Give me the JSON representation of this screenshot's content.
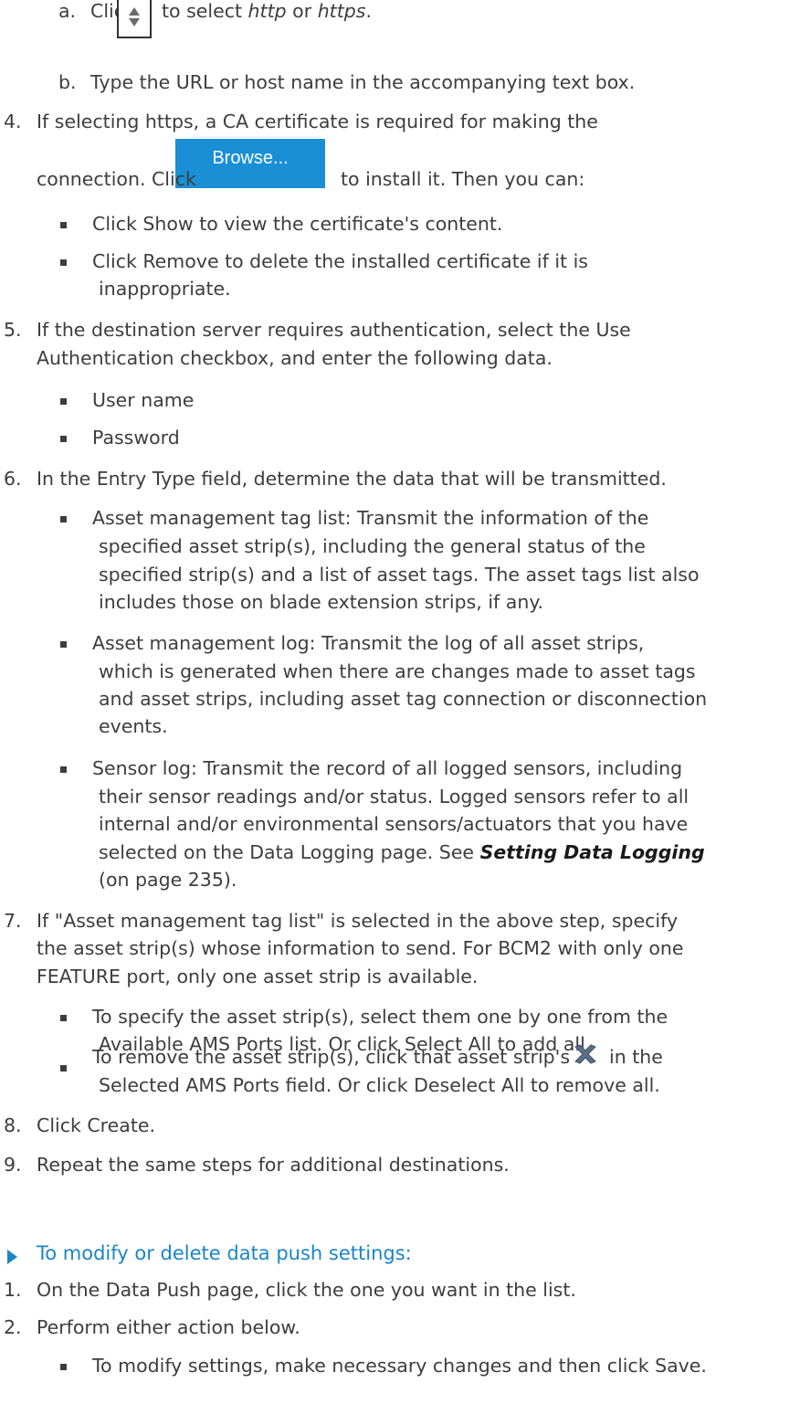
{
  "step3": {
    "a_num": "a.",
    "a_click": "Click",
    "a_to_select": "to select",
    "a_http": "http",
    "a_or": "or",
    "a_https": "https",
    "a_end": ".",
    "b_num": "b.",
    "b_text": "Type the URL or host name in the accompanying text box."
  },
  "step4": {
    "num": "4.",
    "line1": "If selecting https, a CA certificate is required for making the",
    "line2_pre": "connection. Click",
    "line2_post": "to install it. Then you can:",
    "browse_label": "Browse...",
    "bullets": [
      {
        "lines": [
          "Click Show to view the certificate's content."
        ]
      },
      {
        "lines": [
          "Click Remove to delete the installed certificate if it is",
          "inappropriate."
        ]
      }
    ]
  },
  "step5": {
    "num": "5.",
    "lines": [
      "If the destination server requires authentication, select the Use",
      "Authentication checkbox, and enter the following data."
    ],
    "bullets": [
      "User name",
      "Password"
    ]
  },
  "step6": {
    "num": "6.",
    "line": "In the Entry Type field, determine the data that will be transmitted.",
    "bullet1": [
      "Asset management tag list: Transmit the information of the",
      "specified asset strip(s), including the general status of the",
      "specified strip(s) and a list of asset tags. The asset tags list also",
      "includes those on blade extension strips, if any."
    ],
    "bullet2": [
      "Asset management log: Transmit the log of all asset strips,",
      "which is generated when there are changes made to asset tags",
      "and asset strips, including asset tag connection or disconnection",
      "events."
    ],
    "bullet3": [
      "Sensor log: Transmit the record of all logged sensors, including",
      "their sensor readings and/or status. Logged sensors refer to all",
      "internal and/or environmental sensors/actuators that you have"
    ],
    "bullet3_line4_pre": "selected on the Data Logging page. See",
    "bullet3_link": "Setting Data Logging",
    "bullet3_line5": "(on page 235)."
  },
  "step7": {
    "num": "7.",
    "lines": [
      "If \"Asset management tag list\" is selected in the above step, specify",
      "the asset strip(s) whose information to send. For BCM2 with only one",
      "FEATURE port, only one asset strip is available."
    ],
    "bullet1": [
      "To specify the asset strip(s), select them one by one from the",
      "Available AMS Ports list. Or click Select All to add all."
    ],
    "bullet2_pre": "To remove the asset strip(s), click that asset strip's",
    "bullet2_post": "in the",
    "bullet2_line2": "Selected AMS Ports field. Or click Deselect All to remove all."
  },
  "step8": {
    "num": "8.",
    "text": "Click Create."
  },
  "step9": {
    "num": "9.",
    "text": "Repeat the same steps for additional destinations."
  },
  "section2": {
    "heading": "To modify or delete data push settings:",
    "step1_num": "1.",
    "step1": "On the Data Push page, click the one you want in the list.",
    "step2_num": "2.",
    "step2": "Perform either action below.",
    "bullet1": "To modify settings, make necessary changes and then click Save."
  },
  "colors": {
    "accent": "#1b85c8",
    "button": "#1a8fd6",
    "text": "#3d3d3d"
  },
  "icons": [
    "spinner-icon",
    "browse-button",
    "delete-x-icon",
    "section-marker-icon"
  ]
}
